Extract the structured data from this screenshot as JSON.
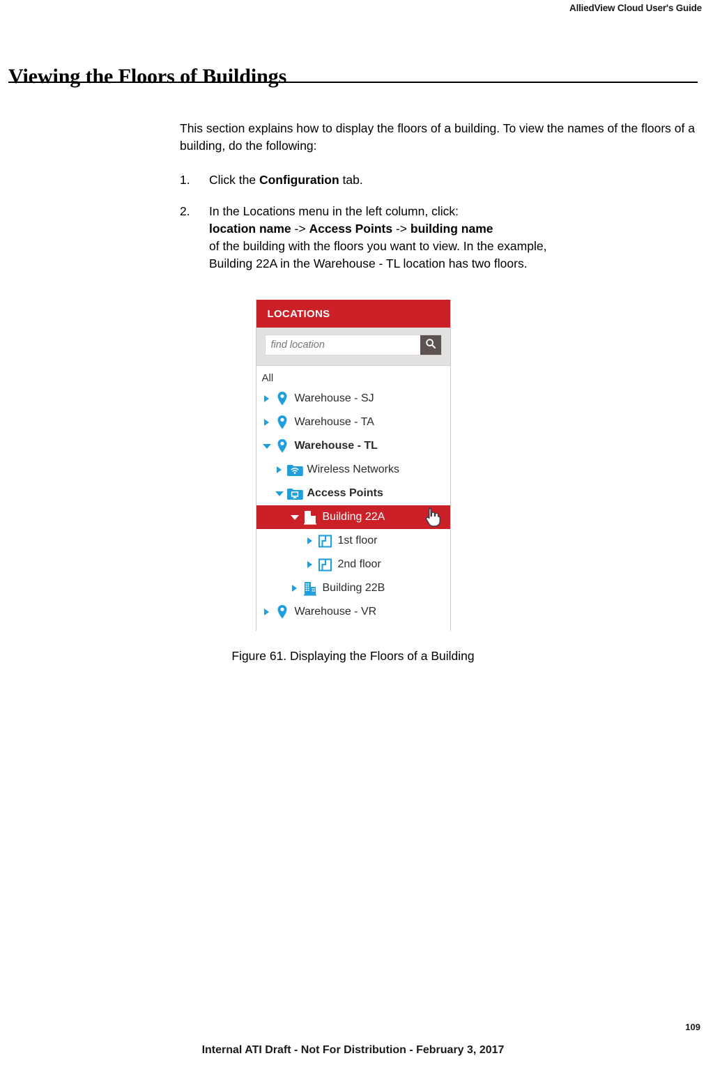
{
  "header": {
    "running_title": "AlliedView Cloud User's Guide"
  },
  "page": {
    "title": "Viewing the Floors of Buildings",
    "number": "109",
    "footer_note": "Internal ATI Draft - Not For Distribution - February 3, 2017"
  },
  "body": {
    "intro": "This section explains how to display the floors of a building. To view the names of the floors of a building, do the following:",
    "steps": [
      {
        "number": "1.",
        "line1_a": "Click the ",
        "line1_bold": "Configuration",
        "line1_b": " tab."
      },
      {
        "number": "2.",
        "line1": "In the Locations menu in the left column, click:",
        "line2_bold_a": "location name",
        "line2_sep_a": " -> ",
        "line2_bold_b": "Access Points",
        "line2_sep_b": " -> ",
        "line2_bold_c": "building name",
        "line3": "of the building with the floors you want to view. In the example,",
        "line4": "Building 22A in the Warehouse - TL location has two floors."
      }
    ]
  },
  "figure": {
    "caption": "Figure 61. Displaying the Floors of a Building",
    "panel": {
      "header_title": "LOCATIONS",
      "search_placeholder": "find location",
      "search_value": "",
      "search_icon": "search-icon",
      "all_label": "All",
      "tree": [
        {
          "label": "Warehouse - SJ",
          "icon": "map-pin-icon",
          "expander": "right",
          "indent": 0,
          "bold": false,
          "selected": false
        },
        {
          "label": "Warehouse - TA",
          "icon": "map-pin-icon",
          "expander": "right",
          "indent": 0,
          "bold": false,
          "selected": false
        },
        {
          "label": "Warehouse - TL",
          "icon": "map-pin-icon",
          "expander": "down",
          "indent": 0,
          "bold": true,
          "selected": false
        },
        {
          "label": "Wireless Networks",
          "icon": "wifi-folder-icon",
          "expander": "right",
          "indent": 1,
          "bold": false,
          "selected": false
        },
        {
          "label": "Access Points",
          "icon": "monitor-folder-icon",
          "expander": "down",
          "indent": 1,
          "bold": true,
          "selected": false
        },
        {
          "label": "Building 22A",
          "icon": "building-icon",
          "expander": "down",
          "indent": 2,
          "bold": false,
          "selected": true
        },
        {
          "label": "1st floor",
          "icon": "floorplan-icon",
          "expander": "right",
          "indent": 3,
          "bold": false,
          "selected": false
        },
        {
          "label": "2nd floor",
          "icon": "floorplan-icon",
          "expander": "right",
          "indent": 3,
          "bold": false,
          "selected": false
        },
        {
          "label": "Building 22B",
          "icon": "building-icon",
          "expander": "right",
          "indent": 2,
          "bold": false,
          "selected": false
        },
        {
          "label": "Warehouse - VR",
          "icon": "map-pin-icon",
          "expander": "right",
          "indent": 0,
          "bold": false,
          "selected": false
        }
      ],
      "cursor": "hand-pointer-cursor"
    }
  },
  "colors": {
    "brand_red": "#cc2028",
    "icon_blue": "#1f9fdc",
    "search_button": "#5c524f",
    "search_area": "#e3e1df"
  }
}
